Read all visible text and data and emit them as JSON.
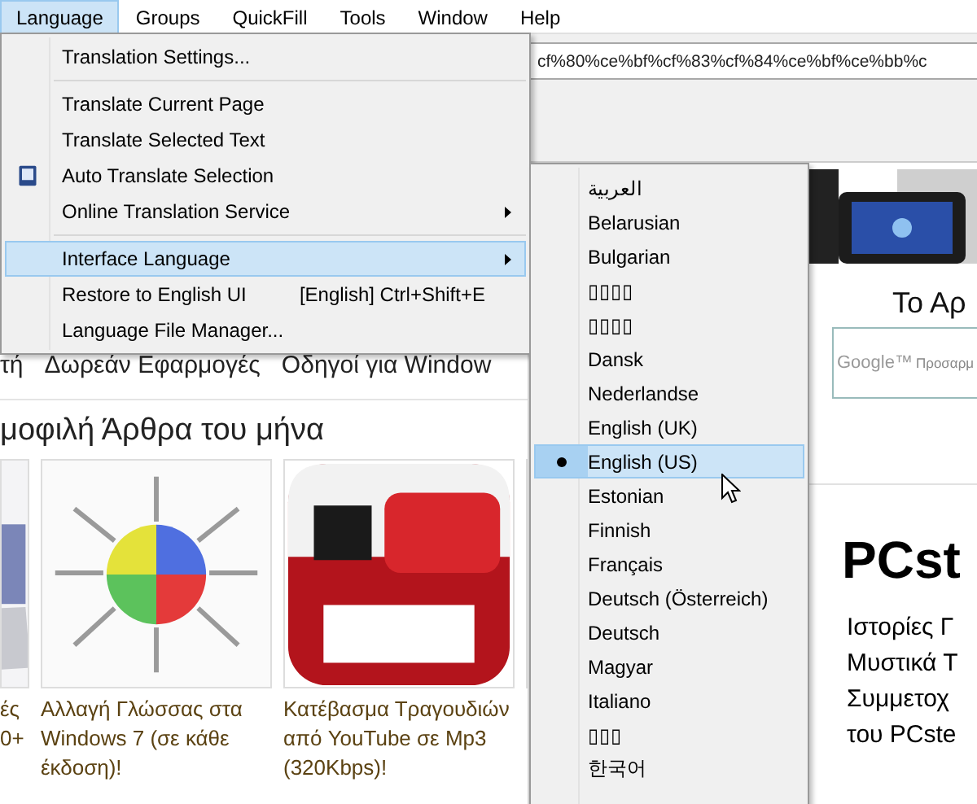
{
  "menubar": [
    {
      "label": "Language",
      "selected": true
    },
    {
      "label": "Groups",
      "selected": false
    },
    {
      "label": "QuickFill",
      "selected": false
    },
    {
      "label": "Tools",
      "selected": false
    },
    {
      "label": "Window",
      "selected": false
    },
    {
      "label": "Help",
      "selected": false
    }
  ],
  "address": {
    "value": "cf%80%ce%bf%cf%83%cf%84%ce%bf%ce%bb%c"
  },
  "language_menu": [
    {
      "kind": "item",
      "label": "Translation Settings...",
      "highlighted": false
    },
    {
      "kind": "separator"
    },
    {
      "kind": "item",
      "label": "Translate Current Page",
      "highlighted": false
    },
    {
      "kind": "item",
      "label": "Translate Selected Text",
      "highlighted": false
    },
    {
      "kind": "item",
      "label": "Auto Translate Selection",
      "highlighted": false,
      "has_icon": true
    },
    {
      "kind": "item",
      "label": "Online Translation Service",
      "highlighted": false,
      "submenu": true
    },
    {
      "kind": "separator"
    },
    {
      "kind": "item",
      "label": "Interface Language",
      "highlighted": true,
      "submenu": true
    },
    {
      "kind": "item",
      "label": "Restore to English UI",
      "highlighted": false,
      "shortcut": "[English] Ctrl+Shift+E"
    },
    {
      "kind": "item",
      "label": "Language File Manager...",
      "highlighted": false
    }
  ],
  "interface_languages": [
    {
      "label": "العربية",
      "selected": false
    },
    {
      "label": "Belarusian",
      "selected": false
    },
    {
      "label": "Bulgarian",
      "selected": false
    },
    {
      "label": "▯▯▯▯",
      "selected": false
    },
    {
      "label": "▯▯▯▯",
      "selected": false
    },
    {
      "label": "Dansk",
      "selected": false
    },
    {
      "label": "Nederlandse",
      "selected": false
    },
    {
      "label": "English (UK)",
      "selected": false
    },
    {
      "label": "English (US)",
      "selected": true
    },
    {
      "label": "Estonian",
      "selected": false
    },
    {
      "label": "Finnish",
      "selected": false
    },
    {
      "label": "Français",
      "selected": false
    },
    {
      "label": "Deutsch (Österreich)",
      "selected": false
    },
    {
      "label": "Deutsch",
      "selected": false
    },
    {
      "label": "Magyar",
      "selected": false
    },
    {
      "label": "Italiano",
      "selected": false
    },
    {
      "label": "▯▯▯",
      "selected": false
    },
    {
      "label": "한국어",
      "selected": false
    }
  ],
  "webpage": {
    "nav": [
      "τή",
      "Δωρεάν Εφαρμογές",
      "Οδηγοί για Window"
    ],
    "heading": "μοφιλή Άρθρα του μήνα",
    "articles": [
      {
        "kind": "laptop",
        "lines": [
          "ές",
          "0+"
        ]
      },
      {
        "kind": "chart",
        "lines": [
          "Αλλαγή Γλώσσας στα",
          "Windows 7 (σε κάθε",
          "έκδοση)!"
        ]
      },
      {
        "kind": "video",
        "lines": [
          "Κατέβασμα Τραγουδιών",
          "από YouTube σε Mp3",
          "(320Kbps)!"
        ]
      },
      {
        "kind": "partial"
      }
    ],
    "side_heading": "Το Αρ",
    "search": {
      "logo": "Google™",
      "placeholder": "Προσαρμ"
    },
    "brand": "PCst",
    "side_links": [
      "Ιστορίες Γ",
      "Μυστικά Τ",
      "Συμμετοχ",
      "του PCste"
    ]
  }
}
